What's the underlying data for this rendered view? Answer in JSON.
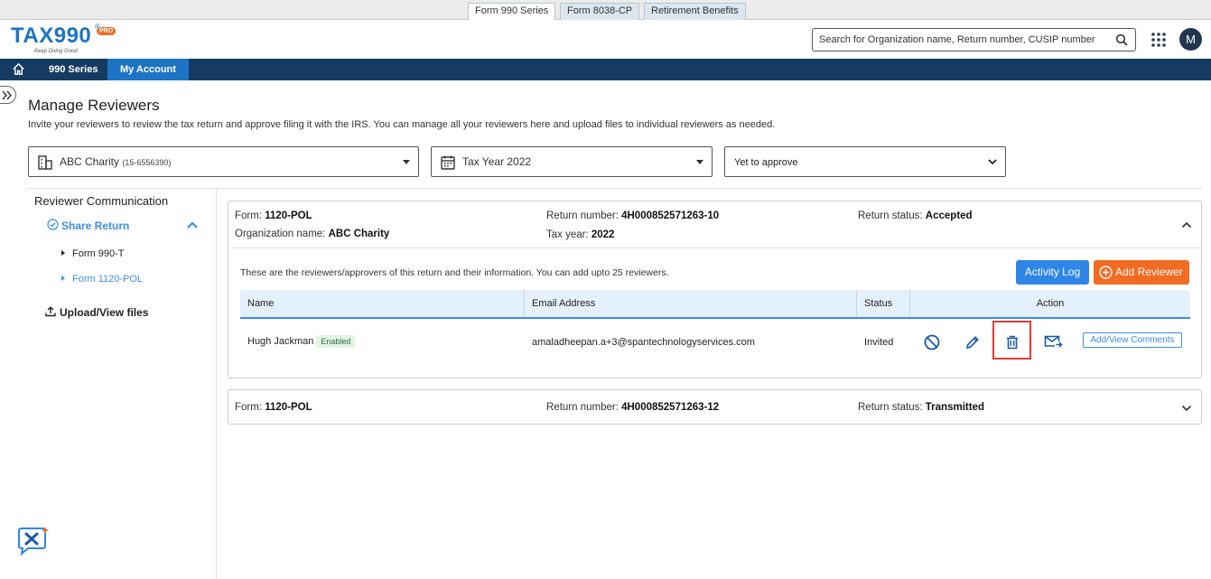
{
  "top_tabs": [
    "Form 990 Series",
    "Form 8038-CP",
    "Retirement Benefits"
  ],
  "logo": {
    "text_a": "TA",
    "text_x": "X",
    "text_b": "990",
    "badge": "PRO",
    "tagline": "Keep Doing Good",
    "reg": "®"
  },
  "search": {
    "placeholder": "Search for Organization name, Return number, CUSIP number"
  },
  "avatar": "M",
  "nav": {
    "series": "990 Series",
    "account": "My Account"
  },
  "page": {
    "title": "Manage Reviewers",
    "description": "Invite your reviewers to review the tax return and approve filing it with the IRS. You can manage all your reviewers here and upload files to individual reviewers as needed."
  },
  "filters": {
    "organization": "ABC Charity",
    "ein": "(15-6556390)",
    "tax_year": "Tax Year 2022",
    "status": "Yet to approve"
  },
  "sidebar": {
    "title": "Reviewer Communication",
    "share": "Share Return",
    "items": [
      "Form 990-T",
      "Form 1120-POL"
    ],
    "upload": "Upload/View files"
  },
  "returns": [
    {
      "form_label": "Form:",
      "form": "1120-POL",
      "org_label": "Organization name:",
      "org": "ABC Charity",
      "num_label": "Return number:",
      "number": "4H000852571263-10",
      "year_label": "Tax year:",
      "year": "2022",
      "status_label": "Return status:",
      "status": "Accepted",
      "note": "These are the reviewers/approvers of this return and their information. You can add upto 25 reviewers.",
      "activity_log": "Activity Log",
      "add_reviewer": "Add Reviewer",
      "columns": [
        "Name",
        "Email Address",
        "Status",
        "Action"
      ],
      "reviewer": {
        "name": "Hugh Jackman",
        "badge": "Enabled",
        "email": "amaladheepan.a+3@spantechnologyservices.com",
        "status": "Invited",
        "comments": "Add/View Comments"
      }
    },
    {
      "form_label": "Form:",
      "form": "1120-POL",
      "num_label": "Return number:",
      "number": "4H000852571263-12",
      "status_label": "Return status:",
      "status": "Transmitted"
    }
  ],
  "colors": {
    "nav": "#153b62",
    "accent": "#1d74c4",
    "link": "#3b8ee8",
    "orange": "#f26b22",
    "highlight": "#e53935"
  }
}
